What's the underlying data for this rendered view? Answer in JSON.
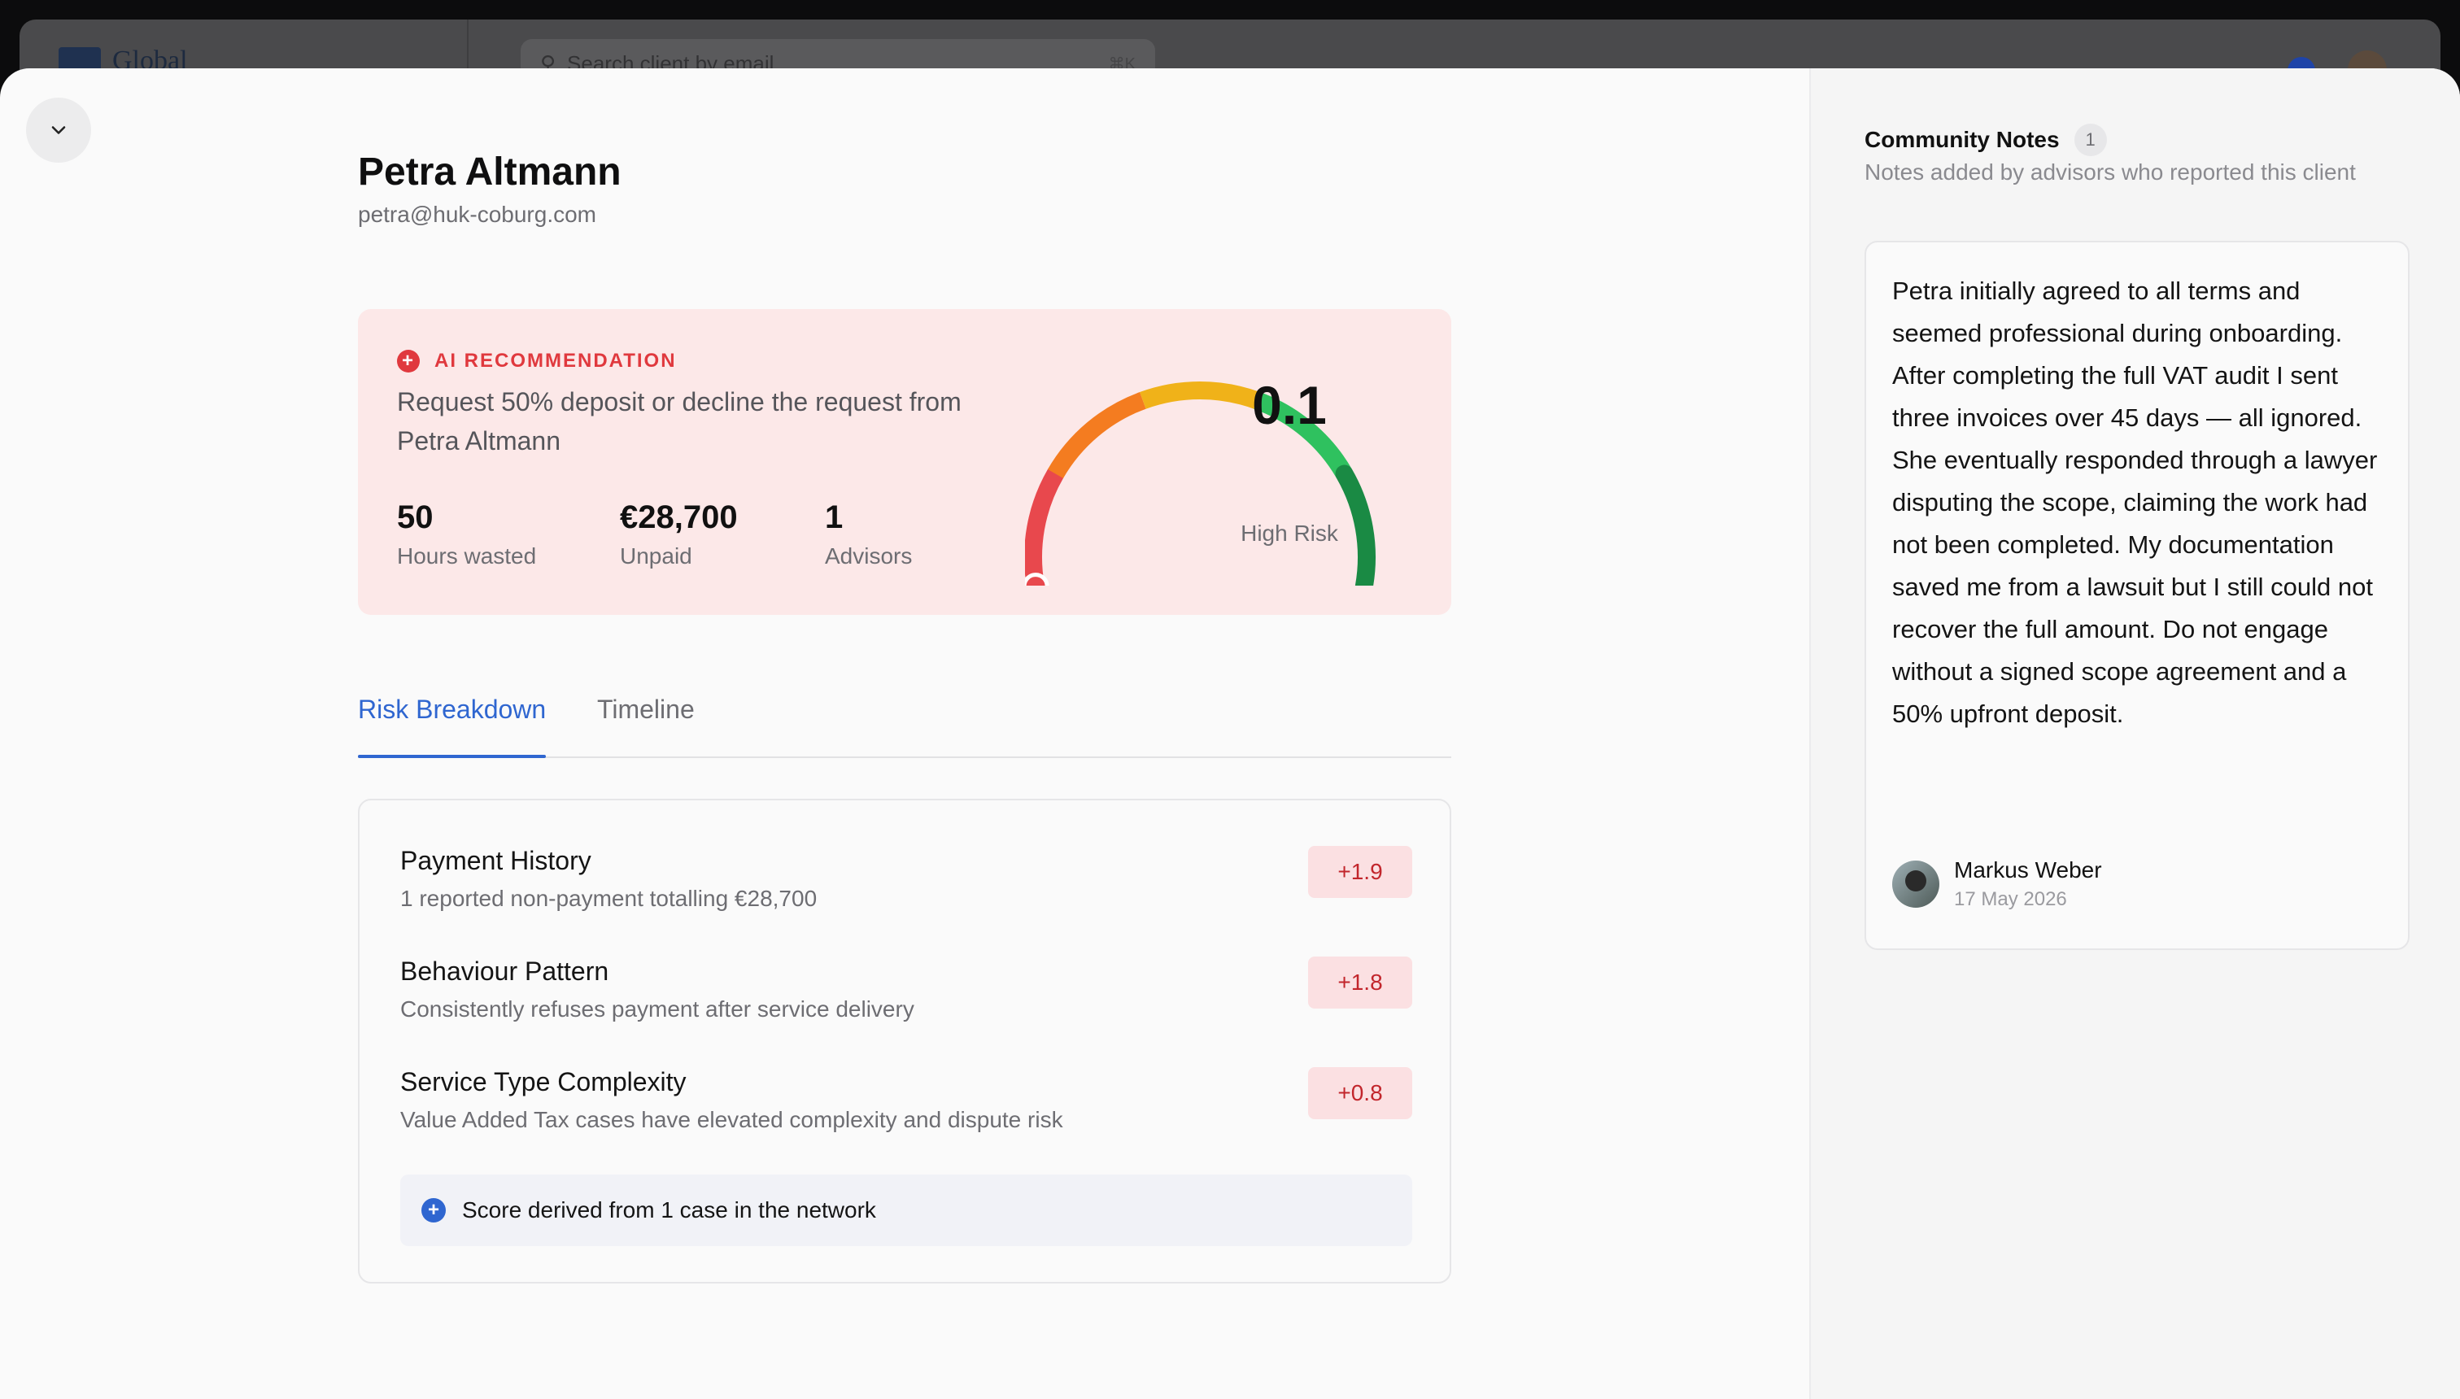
{
  "background": {
    "logo_text": "Global",
    "search_placeholder": "Search client by email",
    "search_shortcut": "⌘K"
  },
  "client": {
    "name": "Petra Altmann",
    "email": "petra@huk-coburg.com"
  },
  "recommendation": {
    "tag": "AI RECOMMENDATION",
    "text": "Request 50% deposit or decline the request from Petra Altmann",
    "stats": [
      {
        "value": "50",
        "label": "Hours wasted"
      },
      {
        "value": "€28,700",
        "label": "Unpaid"
      },
      {
        "value": "1",
        "label": "Advisors"
      }
    ],
    "gauge": {
      "score": "0.1",
      "label": "High Risk",
      "level": 0.0,
      "colors": [
        "#e8484d",
        "#f47c20",
        "#f0b219",
        "#2fc15f",
        "#1a8a44"
      ]
    }
  },
  "tabs": [
    "Risk Breakdown",
    "Timeline"
  ],
  "active_tab": "Risk Breakdown",
  "breakdown": {
    "rows": [
      {
        "title": "Payment History",
        "subtitle": "1 reported non-payment totalling €28,700",
        "score": "+1.9"
      },
      {
        "title": "Behaviour Pattern",
        "subtitle": "Consistently refuses payment after service delivery",
        "score": "+1.8"
      },
      {
        "title": "Service Type Complexity",
        "subtitle": "Value Added Tax cases have elevated complexity and dispute risk",
        "score": "+0.8"
      }
    ],
    "footer": "Score derived from 1 case in the network"
  },
  "community_notes": {
    "title": "Community Notes",
    "count": "1",
    "subtitle": "Notes added by advisors who reported this client",
    "note": {
      "text": "Petra initially agreed to all terms and seemed professional during onboarding. After completing the full VAT audit I sent three invoices over 45 days — all ignored. She eventually responded through a lawyer disputing the scope, claiming the work had not been completed. My documentation saved me from a lawsuit but I still could not recover the full amount. Do not engage without a signed scope agreement and a 50% upfront deposit.",
      "author": "Markus Weber",
      "date": "17 May 2026"
    }
  },
  "colors": {
    "accent": "#2f66d0",
    "danger": "#e0393e",
    "reco_bg": "#fce8e8",
    "chip_bg": "#fbe0e2"
  }
}
